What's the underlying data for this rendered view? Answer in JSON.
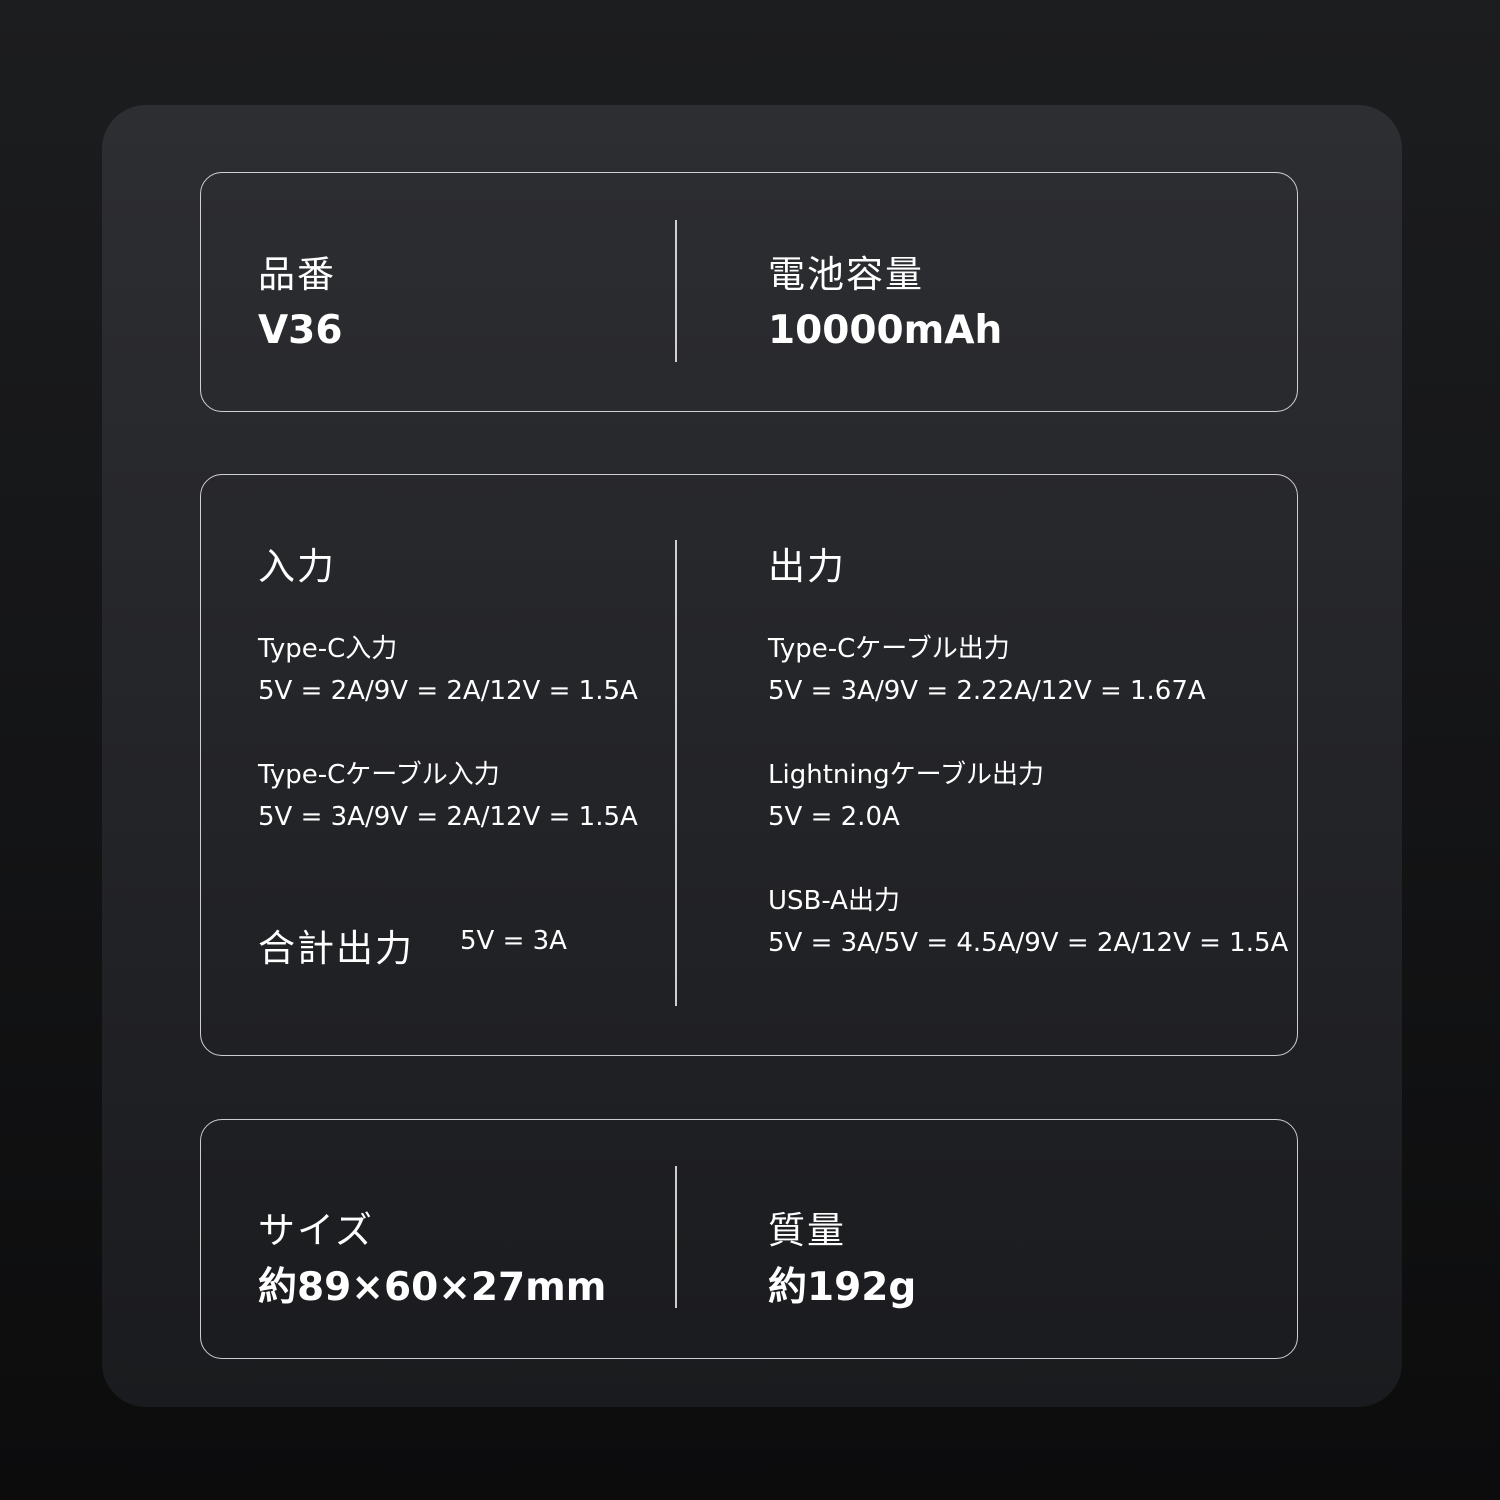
{
  "model": {
    "label": "品番",
    "value": "V36"
  },
  "capacity": {
    "label": "電池容量",
    "value": "10000mAh"
  },
  "input": {
    "heading": "入力",
    "items": [
      {
        "name": "Type-C入力",
        "spec": "5V = 2A/9V = 2A/12V = 1.5A"
      },
      {
        "name": "Type-Cケーブル入力",
        "spec": "5V = 3A/9V = 2A/12V = 1.5A"
      }
    ],
    "total": {
      "label": "合計出力",
      "spec": "5V = 3A"
    }
  },
  "output": {
    "heading": "出力",
    "items": [
      {
        "name": "Type-Cケーブル出力",
        "spec": "5V = 3A/9V = 2.22A/12V = 1.67A"
      },
      {
        "name": "Lightningケーブル出力",
        "spec": "5V = 2.0A"
      },
      {
        "name": "USB-A出力",
        "spec": "5V = 3A/5V = 4.5A/9V = 2A/12V = 1.5A"
      }
    ]
  },
  "size": {
    "label": "サイズ",
    "value": "約89×60×27mm"
  },
  "weight": {
    "label": "質量",
    "value": "約192g"
  }
}
